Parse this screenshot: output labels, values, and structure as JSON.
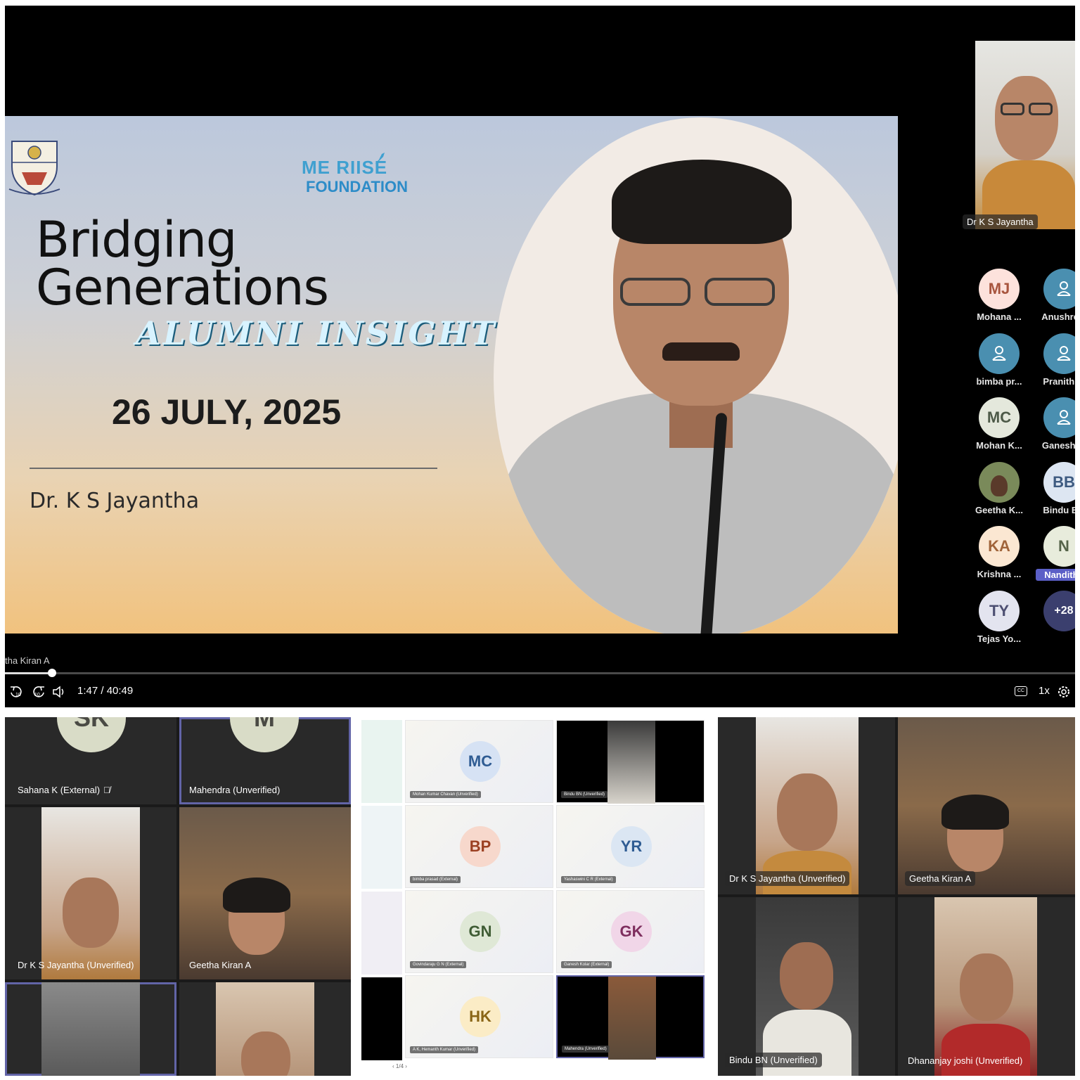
{
  "player": {
    "slide": {
      "logo_line1": "ME RIISE",
      "logo_line2": "FOUNDATION",
      "title_line1": "Bridging",
      "title_line2": "Generations",
      "subtitle": "ALUMNI INSIGHTS",
      "date": "26 JULY, 2025",
      "speaker": "Dr. K S Jayantha"
    },
    "self_view_name": "Dr K S Jayantha",
    "participants": [
      {
        "initials": "MJ",
        "name": "Mohana ...",
        "bg": "#fde2dc",
        "fg": "#a8553e"
      },
      {
        "initials": "",
        "name": "Anushre...",
        "bg": "#4a8fb0",
        "fg": "#ffffff",
        "icon": "person-icon"
      },
      {
        "initials": "",
        "name": "bimba pr...",
        "bg": "#4a8fb0",
        "fg": "#ffffff",
        "icon": "person-icon"
      },
      {
        "initials": "",
        "name": "Pranith ...",
        "bg": "#4a8fb0",
        "fg": "#ffffff",
        "icon": "person-icon"
      },
      {
        "initials": "MC",
        "name": "Mohan K...",
        "bg": "#e4e8dc",
        "fg": "#4d5a48"
      },
      {
        "initials": "",
        "name": "Ganesh ...",
        "bg": "#4a8fb0",
        "fg": "#ffffff",
        "icon": "person-icon"
      },
      {
        "initials": "",
        "name": "Geetha K...",
        "bg": "#7a8a5a",
        "fg": "#ffffff",
        "photo": true
      },
      {
        "initials": "BB",
        "name": "Bindu BN",
        "bg": "#dde6f2",
        "fg": "#3d5a80"
      },
      {
        "initials": "KA",
        "name": "Krishna ...",
        "bg": "#fbe7d2",
        "fg": "#a0643a"
      },
      {
        "initials": "N",
        "name": "Nanditha",
        "bg": "#e8ecdc",
        "fg": "#56644a",
        "highlight": true
      },
      {
        "initials": "TY",
        "name": "Tejas Yo...",
        "bg": "#e3e4ef",
        "fg": "#4d4f72"
      },
      {
        "initials": "+28",
        "name": "",
        "bg": "#3b3f6e",
        "fg": "#ffffff"
      }
    ],
    "caption": "tha Kiran A",
    "time": "1:47 / 40:49",
    "speed": "1x",
    "skip_back": "10",
    "skip_fwd": "10",
    "cc": "CC",
    "progress": 0.044
  },
  "panel1": {
    "tiles": [
      {
        "name": "Sahana K (External)",
        "initials": "SK"
      },
      {
        "name": "Mahendra  (Unverified)",
        "initials": "M"
      },
      {
        "name": "Dr K S Jayantha  (Unverified)"
      },
      {
        "name": "Geetha Kiran A"
      }
    ]
  },
  "panel2": {
    "tiles": [
      {
        "initials": "MC",
        "label": "Mohan Kumar Chavan (Unverified)",
        "bg": "#d6e2f4",
        "fg": "#2f5c93"
      },
      {
        "label": "Bindu BN (Unverified)",
        "video": true
      },
      {
        "initials": "BP",
        "label": "bimba prasad (External)",
        "bg": "#f7d8cc",
        "fg": "#9b3f21"
      },
      {
        "initials": "YR",
        "label": "Yashaswini C R (External)",
        "bg": "#dbe6f3",
        "fg": "#2f5c93"
      },
      {
        "initials": "GN",
        "label": "Govindaraju G N (External)",
        "bg": "#dfe8d6",
        "fg": "#3f5c34"
      },
      {
        "initials": "GK",
        "label": "Ganesh Kolar (External)",
        "bg": "#f1d6e8",
        "fg": "#7e2e5e"
      },
      {
        "initials": "HK",
        "label": "A K, Hemanth Kumar (Unverified)",
        "bg": "#fbecc6",
        "fg": "#8a6516"
      },
      {
        "label": "Mahendra (Unverified)",
        "video": true
      }
    ],
    "pager": "1/4"
  },
  "panel3": {
    "tiles": [
      {
        "name": "Dr K S Jayantha  (Unverified)"
      },
      {
        "name": "Geetha Kiran A"
      },
      {
        "name": "Bindu BN  (Unverified)"
      },
      {
        "name": "Dhananjay joshi (Unverified)"
      }
    ]
  }
}
